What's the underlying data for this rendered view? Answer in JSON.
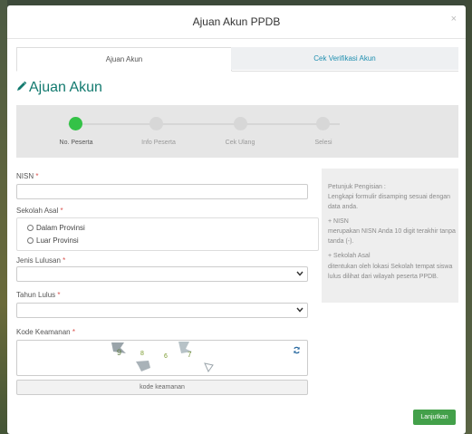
{
  "modal": {
    "title": "Ajuan Akun PPDB",
    "close": "×"
  },
  "tabs": [
    {
      "label": "Ajuan Akun",
      "active": true
    },
    {
      "label": "Cek Verifikasi Akun",
      "active": false
    }
  ],
  "heading": "Ajuan Akun",
  "steps": [
    {
      "label": "No. Peserta",
      "active": true
    },
    {
      "label": "Info Peserta",
      "active": false
    },
    {
      "label": "Cek Ulang",
      "active": false
    },
    {
      "label": "Selesi",
      "active": false
    }
  ],
  "form": {
    "nisn_label": "NISN",
    "nisn_value": "",
    "sekolah_label": "Sekolah Asal",
    "radio_dalam": "Dalam Provinsi",
    "radio_luar": "Luar Provinsi",
    "jenis_label": "Jenis Lulusan",
    "jenis_value": "",
    "tahun_label": "Tahun Lulus",
    "tahun_value": "",
    "kode_label": "Kode Keamanan",
    "kode_button": "kode keamanan",
    "required_mark": "*"
  },
  "captcha": {
    "chars": [
      "9",
      "8",
      "6",
      "7"
    ]
  },
  "help": {
    "title": "Petunjuk Pengisian :",
    "intro": "Lengkapi formulir disamping sesuai dengan data anda.",
    "nisn_title": "+ NISN",
    "nisn_text": "merupakan NISN Anda 10 digit terakhir tanpa tanda (-).",
    "sekolah_title": "+ Sekolah Asal",
    "sekolah_text": "ditentukan oleh lokasi Sekolah tempat siswa lulus dilihat dari wilayah peserta PPDB."
  },
  "next_button": "Lanjutkan",
  "colors": {
    "accent": "#43a04a",
    "heading": "#137a6f",
    "step_active": "#34c247",
    "link": "#1f8fb0",
    "required": "#d9534f"
  }
}
